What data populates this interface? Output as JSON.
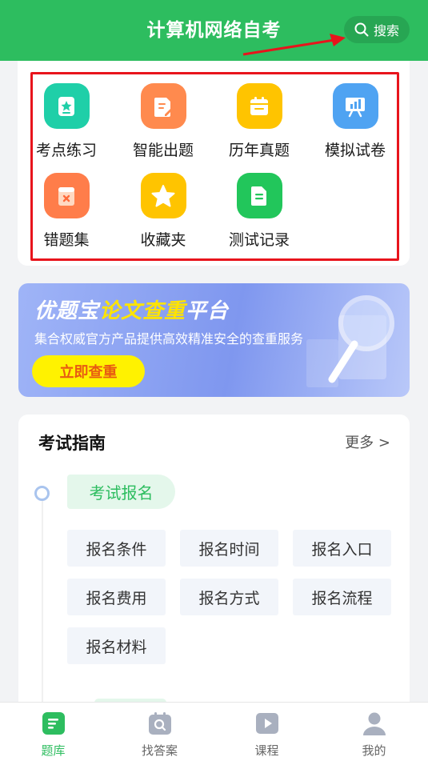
{
  "header": {
    "title": "计算机网络自考",
    "search_label": "搜索"
  },
  "grid": {
    "items": [
      {
        "label": "考点练习",
        "icon": "star-doc-icon",
        "color": "#1fcfa8"
      },
      {
        "label": "智能出题",
        "icon": "edit-doc-icon",
        "color": "#ff8a4e"
      },
      {
        "label": "历年真题",
        "icon": "calendar-icon",
        "color": "#ffc400"
      },
      {
        "label": "模拟试卷",
        "icon": "board-chart-icon",
        "color": "#4fa3f2"
      },
      {
        "label": "错题集",
        "icon": "wrong-doc-icon",
        "color": "#ff7d4a"
      },
      {
        "label": "收藏夹",
        "icon": "star-icon",
        "color": "#ffc400"
      },
      {
        "label": "测试记录",
        "icon": "record-doc-icon",
        "color": "#22c65b"
      }
    ]
  },
  "banner": {
    "title_part1": "优题宝",
    "title_part2": "论文查重",
    "title_part3": "平台",
    "subtitle": "集合权威官方产品提供高效精准安全的查重服务",
    "button_label": "立即查重"
  },
  "guide": {
    "title": "考试指南",
    "more_label": "更多 >",
    "step_label": "考试报名",
    "tags": [
      "报名条件",
      "报名时间",
      "报名入口",
      "报名费用",
      "报名方式",
      "报名流程",
      "报名材料"
    ]
  },
  "tabbar": {
    "items": [
      {
        "label": "题库",
        "icon": "question-bank-icon"
      },
      {
        "label": "找答案",
        "icon": "find-answer-icon"
      },
      {
        "label": "课程",
        "icon": "course-play-icon"
      },
      {
        "label": "我的",
        "icon": "profile-icon"
      }
    ],
    "active_color": "#2dbd5f"
  }
}
